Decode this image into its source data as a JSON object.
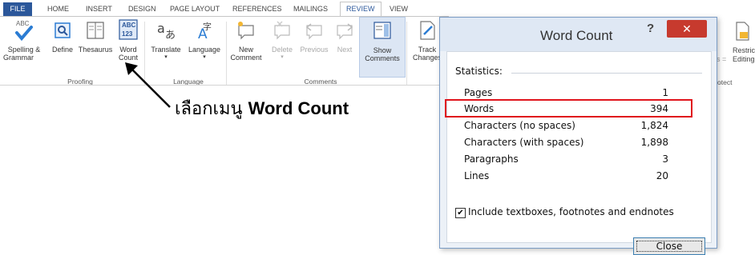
{
  "ribbon": {
    "tabs": [
      "FILE",
      "HOME",
      "INSERT",
      "DESIGN",
      "PAGE LAYOUT",
      "REFERENCES",
      "MAILINGS",
      "REVIEW",
      "VIEW"
    ],
    "active_tab": "REVIEW",
    "groups": {
      "proofing": {
        "label": "Proofing",
        "buttons": [
          {
            "label1": "Spelling &",
            "label2": "Grammar",
            "icon": "spellcheck-icon"
          },
          {
            "label1": "Define",
            "label2": "",
            "icon": "define-icon"
          },
          {
            "label1": "Thesaurus",
            "label2": "",
            "icon": "thesaurus-icon"
          },
          {
            "label1": "Word",
            "label2": "Count",
            "icon": "word-count-icon",
            "icon_text": "ABC\n123"
          }
        ]
      },
      "language": {
        "label": "Language",
        "buttons": [
          {
            "label1": "Translate",
            "icon": "translate-icon"
          },
          {
            "label1": "Language",
            "icon": "language-icon"
          }
        ]
      },
      "comments": {
        "label": "Comments",
        "buttons": [
          {
            "label1": "New",
            "label2": "Comment",
            "icon": "new-comment-icon"
          },
          {
            "label1": "Delete",
            "icon": "delete-comment-icon"
          },
          {
            "label1": "Previous",
            "icon": "previous-comment-icon"
          },
          {
            "label1": "Next",
            "icon": "next-comment-icon"
          },
          {
            "label1": "Show",
            "label2": "Comments",
            "icon": "show-comments-icon"
          }
        ]
      },
      "tracking": {
        "buttons": [
          {
            "label1": "Track",
            "label2": "Changes",
            "icon": "track-changes-icon"
          }
        ]
      },
      "protect_fragment": {
        "label_partial": "otect",
        "restrict_label1": "Restric",
        "restrict_label2": "Editing",
        "s_fragment": "s ="
      }
    }
  },
  "annotation": {
    "thai_text": "เลือกเมนู",
    "bold_text": "Word Count"
  },
  "dialog": {
    "title": "Word Count",
    "help": "?",
    "close_glyph": "✕",
    "statistics_label": "Statistics:",
    "stats": [
      {
        "key": "Pages",
        "value": "1"
      },
      {
        "key": "Words",
        "value": "394"
      },
      {
        "key": "Characters (no spaces)",
        "value": "1,824"
      },
      {
        "key": "Characters (with spaces)",
        "value": "1,898"
      },
      {
        "key": "Paragraphs",
        "value": "3"
      },
      {
        "key": "Lines",
        "value": "20"
      }
    ],
    "include_textboxes_label": "Include textboxes, footnotes and endnotes",
    "include_textboxes_checked": true,
    "close_button": "Close"
  },
  "colors": {
    "file_tab": "#2b579a",
    "highlight_box": "#e0141c",
    "dialog_close": "#c73a2e"
  }
}
